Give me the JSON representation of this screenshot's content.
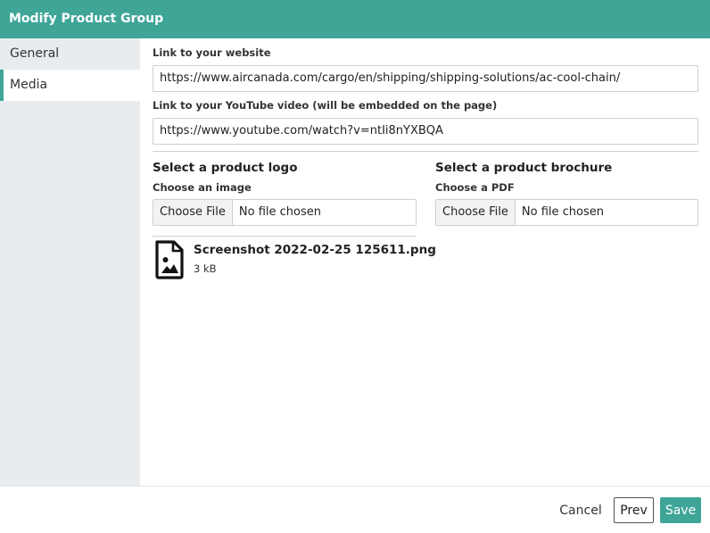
{
  "dialog": {
    "title": "Modify Product Group"
  },
  "sidebar": {
    "items": [
      {
        "label": "General",
        "active": false
      },
      {
        "label": "Media",
        "active": true
      }
    ]
  },
  "media": {
    "website": {
      "label": "Link to your website",
      "value": "https://www.aircanada.com/cargo/en/shipping/shipping-solutions/ac-cool-chain/"
    },
    "youtube": {
      "label": "Link to your YouTube video (will be embedded on the page)",
      "value": "https://www.youtube.com/watch?v=ntIi8nYXBQA"
    },
    "logo": {
      "title": "Select a product logo",
      "sub_label": "Choose an image",
      "button": "Choose File",
      "status": "No file chosen",
      "file": {
        "name": "Screenshot 2022-02-25 125611.png",
        "size": "3 kB",
        "icon": "image-file-icon"
      }
    },
    "brochure": {
      "title": "Select a product brochure",
      "sub_label": "Choose a PDF",
      "button": "Choose File",
      "status": "No file chosen"
    }
  },
  "footer": {
    "cancel": "Cancel",
    "prev": "Prev",
    "save": "Save"
  },
  "colors": {
    "accent": "#3ea597",
    "sidebar_bg": "#e9ecef"
  }
}
